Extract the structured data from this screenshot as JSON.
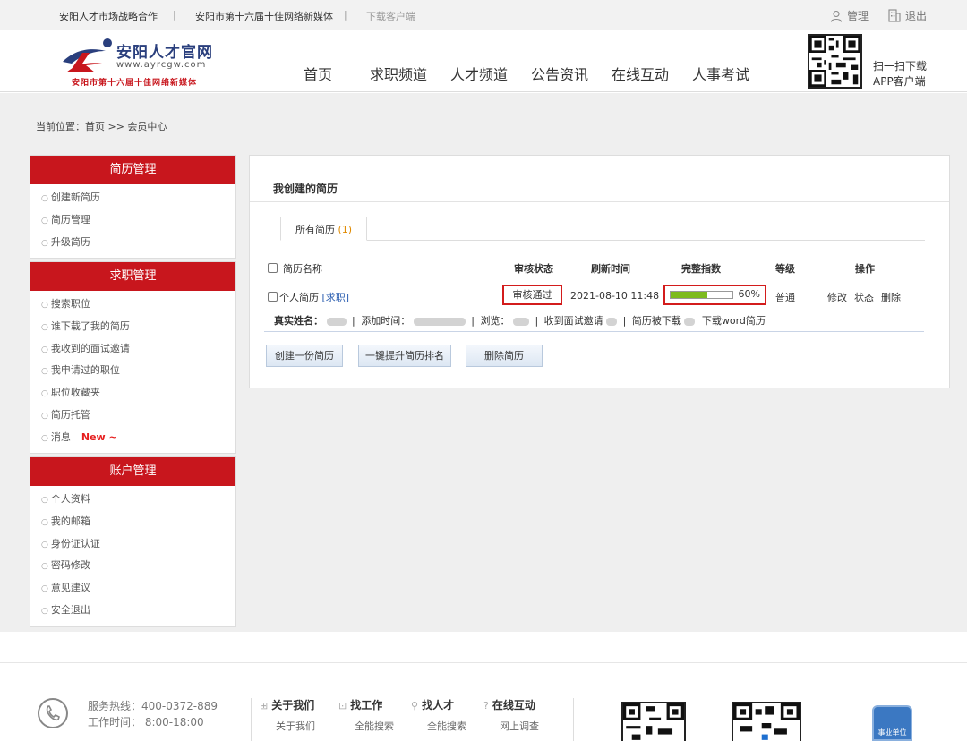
{
  "topbar": {
    "link1": "安阳人才市场战略合作",
    "link2": "安阳市第十六届十佳网络新媒体",
    "download": "下载客户端",
    "sep": "|",
    "manage": "管理",
    "logout": "退出"
  },
  "logo": {
    "name": "安阳人才官网",
    "url": "www.ayrcgw.com",
    "slogan": "安阳市第十六届十佳网络新媒体"
  },
  "nav": [
    "首页",
    "求职频道",
    "人才频道",
    "公告资讯",
    "在线互动",
    "人事考试"
  ],
  "app_download": {
    "line1": "扫一扫下载",
    "line2": "APP客户端"
  },
  "breadcrumb": "当前位置：首页 >> 会员中心",
  "sidebar": {
    "resume": {
      "title": "简历管理",
      "items": [
        "创建新简历",
        "简历管理",
        "升级简历"
      ]
    },
    "job": {
      "title": "求职管理",
      "items": [
        "搜索职位",
        "谁下载了我的简历",
        "我收到的面试邀请",
        "我申请过的职位",
        "职位收藏夹",
        "简历托管",
        "消息"
      ],
      "new_badge": "New ~"
    },
    "account": {
      "title": "账户管理",
      "items": [
        "个人资料",
        "我的邮箱",
        "身份证认证",
        "密码修改",
        "意见建议",
        "安全退出"
      ]
    }
  },
  "main": {
    "title": "我创建的简历",
    "tab": {
      "label": "所有简历",
      "count": "(1)"
    },
    "columns": {
      "name": "简历名称",
      "status": "审核状态",
      "refresh": "刷新时间",
      "completeness": "完整指数",
      "level": "等级",
      "actions": "操作"
    },
    "resume": {
      "name": "个人简历",
      "tag": "[求职]",
      "status": "审核通过",
      "refresh_time": "2021-08-10 11:48",
      "completeness_pct": 60,
      "completeness_label": "60%",
      "level": "普通",
      "edit": "修改",
      "state": "状态",
      "delete": "删除"
    },
    "info": {
      "real_name_label": "真实姓名：",
      "added_label": "添加时间：",
      "views_label": "浏览：",
      "invites_label": "收到面试邀请",
      "downloaded_label": "简历被下载",
      "word_download": "下载word简历",
      "sep": "|"
    },
    "buttons": {
      "create": "创建一份简历",
      "boost": "一键提升简历排名",
      "delete": "删除简历"
    }
  },
  "footer": {
    "hotline": "服务热线：400-0372-889",
    "hours": "工作时间： 8:00-18:00",
    "cols": [
      {
        "title": "关于我们",
        "sub": "关于我们"
      },
      {
        "title": "找工作",
        "sub": "全能搜索"
      },
      {
        "title": "找人才",
        "sub": "全能搜索"
      },
      {
        "title": "在线互动",
        "sub": "网上调查"
      }
    ],
    "badge_text": "事业单位"
  },
  "colors": {
    "brand_red": "#c8161d",
    "progress_green": "#7dbb1e",
    "link_blue": "#2a5db0",
    "new_red": "#e61e1e",
    "count_orange": "#e08a00"
  }
}
